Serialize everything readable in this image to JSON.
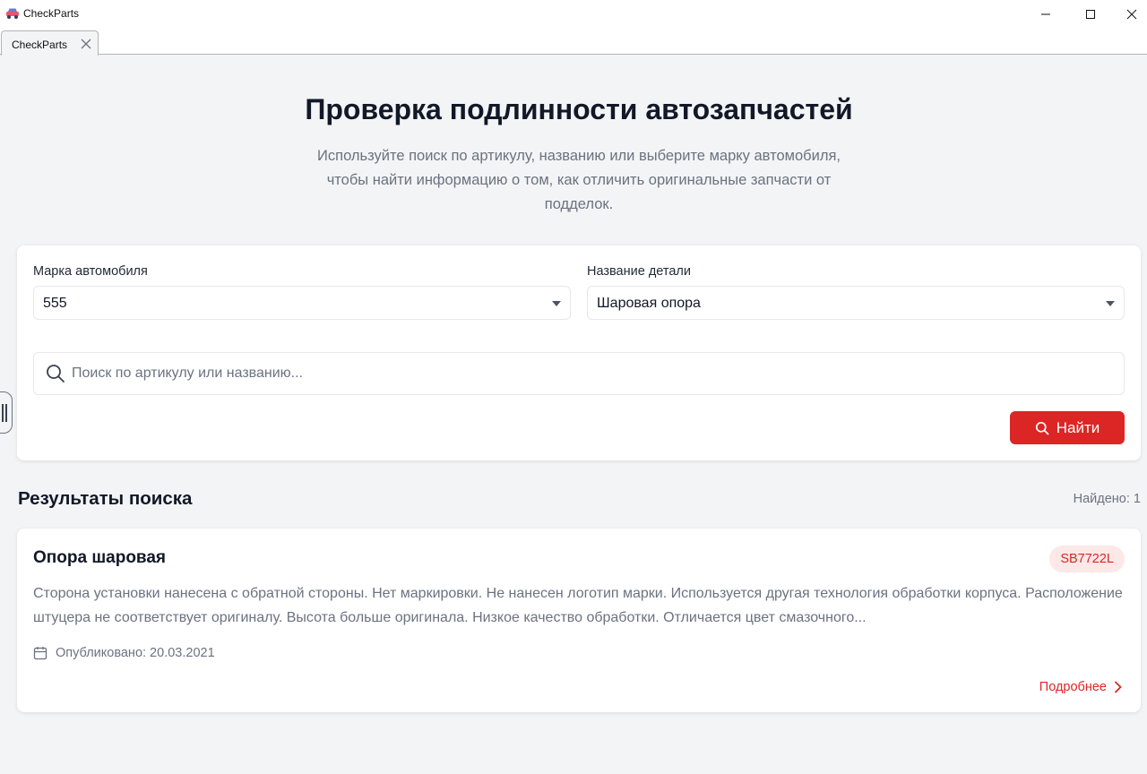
{
  "window": {
    "title": "CheckParts"
  },
  "tab": {
    "label": "CheckParts"
  },
  "hero": {
    "title": "Проверка подлинности автозапчастей",
    "subtitle": "Используйте поиск по артикулу, названию или выберите марку автомобиля, чтобы найти информацию о том, как отличить оригинальные запчасти от подделок."
  },
  "filters": {
    "brand_label": "Марка автомобиля",
    "brand_value": "555",
    "part_label": "Название детали",
    "part_value": "Шаровая опора"
  },
  "search": {
    "placeholder": "Поиск по артикулу или названию...",
    "button_label": "Найти"
  },
  "results": {
    "title": "Результаты поиска",
    "count": "Найдено: 1",
    "items": [
      {
        "name": "Опора шаровая",
        "article": "SB7722L",
        "description": "Сторона установки нанесена с обратной стороны. Нет маркировки. Не нанесен логотип марки. Используется другая технология обработки корпуса. Расположение штуцера не соответствует оригиналу. Высота больше оригинала. Низкое качество обработки. Отличается цвет смазочного...",
        "published": "Опубликовано: 20.03.2021",
        "more_label": "Подробнее"
      }
    ]
  },
  "colors": {
    "accent": "#dc2626",
    "background": "#f3f4f6",
    "badge_bg": "#fde8e8"
  }
}
